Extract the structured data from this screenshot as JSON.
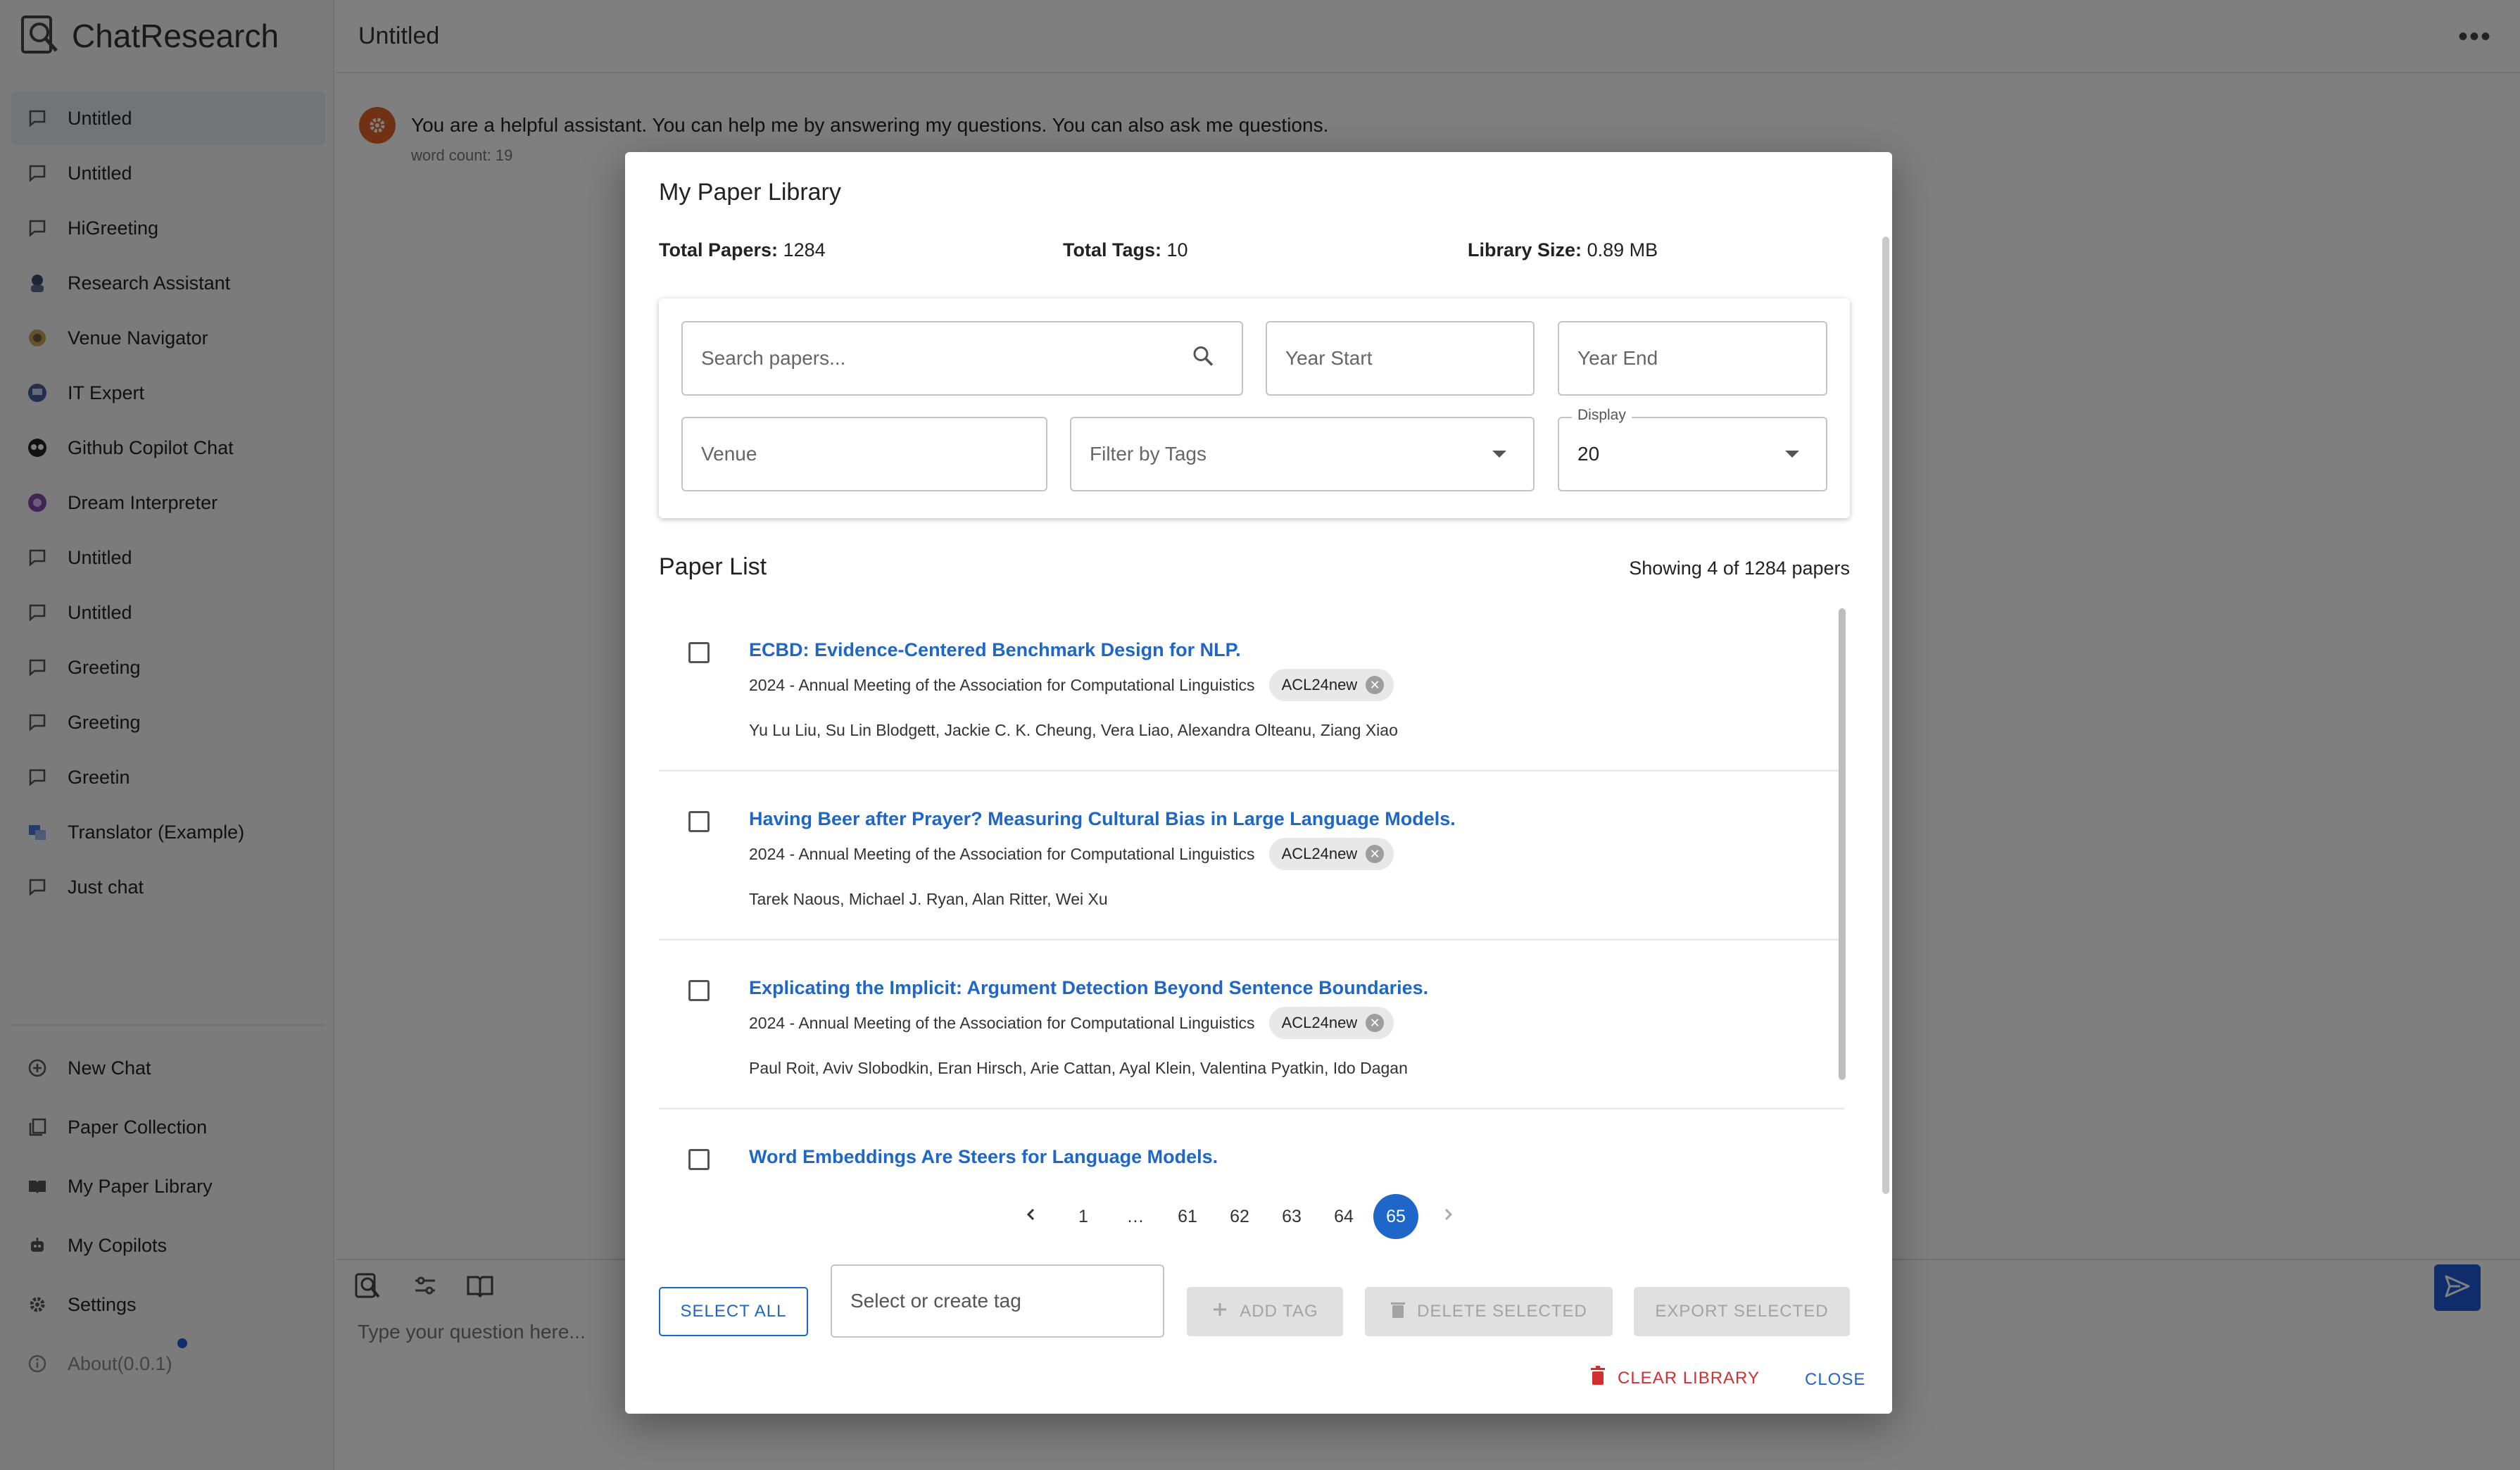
{
  "app": {
    "name": "ChatResearch"
  },
  "sidebar": {
    "items": [
      {
        "label": "Untitled",
        "icon": "chat-bubble-icon",
        "active": true
      },
      {
        "label": "Untitled",
        "icon": "chat-bubble-icon"
      },
      {
        "label": "HiGreeting",
        "icon": "chat-bubble-icon"
      },
      {
        "label": "Research Assistant",
        "icon": "research-assistant-avatar-icon"
      },
      {
        "label": "Venue Navigator",
        "icon": "venue-navigator-avatar-icon"
      },
      {
        "label": "IT Expert",
        "icon": "it-expert-avatar-icon"
      },
      {
        "label": "Github Copilot Chat",
        "icon": "github-copilot-avatar-icon"
      },
      {
        "label": "Dream Interpreter",
        "icon": "dream-interpreter-avatar-icon"
      },
      {
        "label": "Untitled",
        "icon": "chat-bubble-icon"
      },
      {
        "label": "Untitled",
        "icon": "chat-bubble-icon"
      },
      {
        "label": "Greeting",
        "icon": "chat-bubble-icon"
      },
      {
        "label": "Greeting",
        "icon": "chat-bubble-icon"
      },
      {
        "label": "Greetin",
        "icon": "chat-bubble-icon"
      },
      {
        "label": "Translator (Example)",
        "icon": "translator-avatar-icon"
      },
      {
        "label": "Just chat",
        "icon": "chat-bubble-icon"
      }
    ],
    "bottom": {
      "new_chat": "New Chat",
      "paper_collection": "Paper Collection",
      "my_paper_library": "My Paper Library",
      "my_copilots": "My Copilots",
      "settings": "Settings",
      "about": "About(0.0.1)"
    }
  },
  "header": {
    "title": "Untitled"
  },
  "chat": {
    "system_message": "You are a helpful assistant. You can help me by answering my questions. You can also ask me questions.",
    "word_count": "word count: 19"
  },
  "composer": {
    "placeholder": "Type your question here..."
  },
  "dialog": {
    "title": "My Paper Library",
    "stats": {
      "total_papers_label": "Total Papers:",
      "total_papers": "1284",
      "total_tags_label": "Total Tags:",
      "total_tags": "10",
      "library_size_label": "Library Size:",
      "library_size": "0.89 MB"
    },
    "filters": {
      "search_placeholder": "Search papers...",
      "year_start": "Year Start",
      "year_end": "Year End",
      "venue": "Venue",
      "tags": "Filter by Tags",
      "display_label": "Display",
      "display_value": "20"
    },
    "list_title": "Paper List",
    "showing": "Showing 4 of 1284 papers",
    "papers": [
      {
        "title": "ECBD: Evidence-Centered Benchmark Design for NLP.",
        "venue": "2024 - Annual Meeting of the Association for Computational Linguistics",
        "tag": "ACL24new",
        "authors": "Yu Lu Liu, Su Lin Blodgett, Jackie C. K. Cheung, Vera Liao, Alexandra Olteanu, Ziang Xiao"
      },
      {
        "title": "Having Beer after Prayer? Measuring Cultural Bias in Large Language Models.",
        "venue": "2024 - Annual Meeting of the Association for Computational Linguistics",
        "tag": "ACL24new",
        "authors": "Tarek Naous, Michael J. Ryan, Alan Ritter, Wei Xu"
      },
      {
        "title": "Explicating the Implicit: Argument Detection Beyond Sentence Boundaries.",
        "venue": "2024 - Annual Meeting of the Association for Computational Linguistics",
        "tag": "ACL24new",
        "authors": "Paul Roit, Aviv Slobodkin, Eran Hirsch, Arie Cattan, Ayal Klein, Valentina Pyatkin, Ido Dagan"
      },
      {
        "title": "Word Embeddings Are Steers for Language Models.",
        "venue": "",
        "tag": "",
        "authors": ""
      }
    ],
    "pagination": {
      "pages": [
        "1",
        "…",
        "61",
        "62",
        "63",
        "64",
        "65"
      ],
      "current": "65"
    },
    "actions": {
      "select_all": "SELECT ALL",
      "tag_placeholder": "Select or create tag",
      "add_tag": "ADD TAG",
      "delete_selected": "DELETE SELECTED",
      "export_selected": "EXPORT SELECTED",
      "clear_library": "CLEAR LIBRARY",
      "close": "CLOSE"
    }
  },
  "colors": {
    "accent": "#1e66c8",
    "danger": "#d32f2f",
    "send": "#1e5bd6",
    "system_avatar": "#e0632a"
  }
}
